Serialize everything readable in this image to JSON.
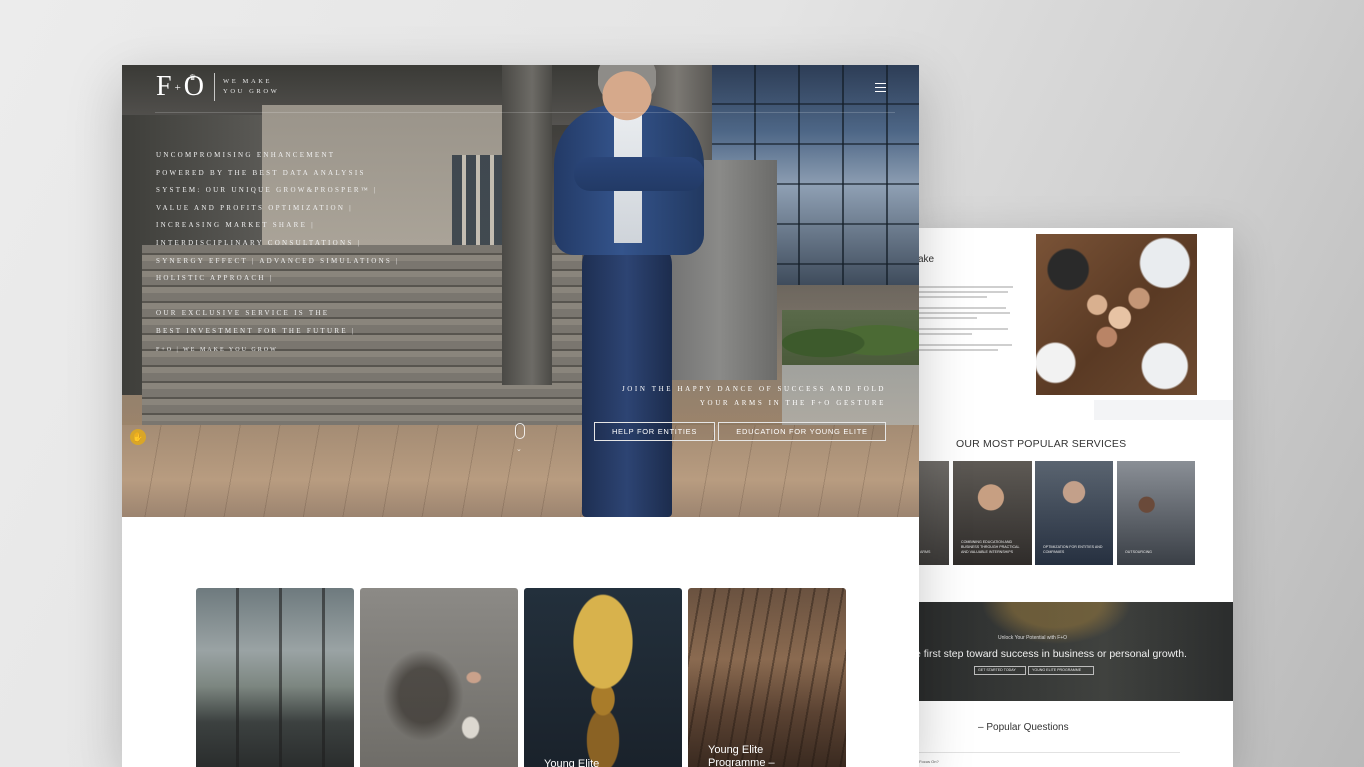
{
  "main": {
    "logo": {
      "mark_left": "F",
      "mark_plus": "+",
      "mark_right": "O",
      "crown": "♛",
      "tagline_1": "WE MAKE",
      "tagline_2": "YOU GROW"
    },
    "hero_lines": [
      "UNCOMPROMISING ENHANCEMENT",
      "POWERED BY THE BEST DATA ANALYSIS",
      "SYSTEM: OUR UNIQUE GROW&PROSPER™ |",
      "VALUE AND PROFITS OPTIMIZATION |",
      "INCREASING MARKET SHARE |",
      "INTERDISCIPLINARY CONSULTATIONS |",
      "SYNERGY EFFECT | ADVANCED SIMULATIONS |",
      "HOLISTIC APPROACH |"
    ],
    "hero_lines_2": [
      "OUR EXCLUSIVE SERVICE IS THE",
      "BEST INVESTMENT FOR THE FUTURE |"
    ],
    "hero_signature": "F+O | WE MAKE YOU GROW",
    "hero_cta_text_1": "JOIN THE HAPPY DANCE OF SUCCESS AND FOLD",
    "hero_cta_text_2": "YOUR ARMS IN THE F+O GESTURE",
    "buttons": {
      "entities": "HELP FOR ENTITIES",
      "young_elite": "EDUCATION FOR YOUNG ELITE"
    },
    "cards": [
      {
        "title": ""
      },
      {
        "title": ""
      },
      {
        "title": "Young Elite"
      },
      {
        "title_1": "Young Elite",
        "title_2": "Programme –"
      }
    ]
  },
  "back": {
    "about_title": "ake",
    "services_title": "OUR MOST POPULAR SERVICES",
    "service_labels": [
      "ARMS",
      "COMBINING EDUCATION AND BUSINESS THROUGH PRACTICAL AND VALUABLE INTERNSHIPS",
      "OPTIMIZATION FOR ENTITIES AND COMPANIES",
      "OUTSOURCING"
    ],
    "cta_kicker": "Unlock Your Potential with F+O",
    "cta_headline": "e first step toward success in business or personal growth.",
    "cta_btn_1": "GET STARTED TODAY",
    "cta_btn_2": "YOUNG ELITE PROGRAMME",
    "faq_title": "– Popular Questions",
    "faq_first": "y Focus On?"
  }
}
